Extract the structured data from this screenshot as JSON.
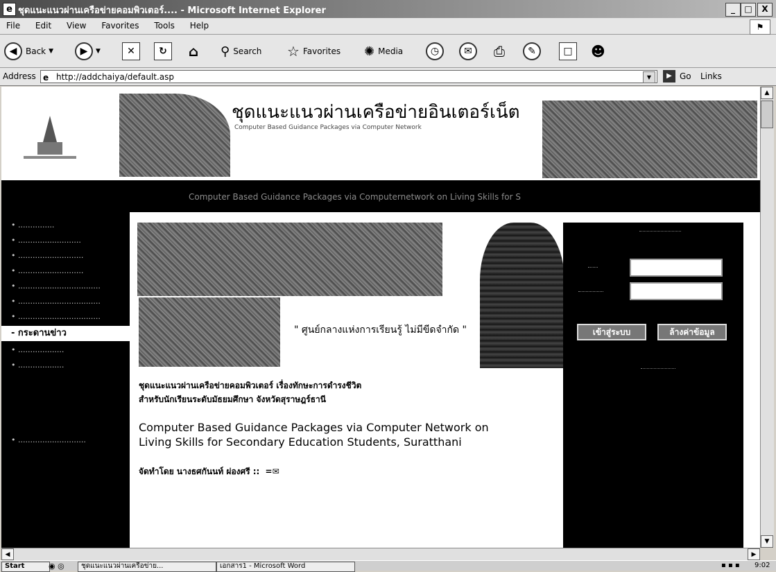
{
  "window": {
    "title": "ชุดแนะแนวผ่านเครือข่ายคอมพิวเตอร์.... - Microsoft Internet Explorer",
    "minimize": "_",
    "maximize": "□",
    "close": "X"
  },
  "menu": [
    "File",
    "Edit",
    "View",
    "Favorites",
    "Tools",
    "Help"
  ],
  "toolbar": {
    "back": "Back",
    "search": "Search",
    "favorites": "Favorites",
    "media": "Media"
  },
  "address": {
    "label": "Address",
    "url": "http://addchaiya/default.asp",
    "go": "Go",
    "links": "Links"
  },
  "banner": {
    "title_th": "ชุดแนะแนวผ่านเครือข่ายอินเตอร์เน็ต",
    "title_en": "Computer Based Guidance Packages via Computer Network",
    "band_text": "Computer Based Guidance Packages via Computernetwork on Living Skills for S"
  },
  "nav": {
    "active": "- กระดานข่าว"
  },
  "main": {
    "slogan": "\" ศูนย์กลางแห่งการเรียนรู้ ไม่มีขีดจำกัด \"",
    "desc_th_1": "ชุดแนะแนวผ่านเครือข่ายคอมพิวเตอร์ เรื่องทักษะการดำรงชีวิต",
    "desc_th_2": "สำหรับนักเรียนระดับมัธยมศึกษา จังหวัดสุราษฎร์ธานี",
    "desc_en_1": "Computer Based Guidance Packages via Computer Network on",
    "desc_en_2": "Living Skills for Secondary Education Students, Suratthani",
    "author": "จัดทำโดย นางธศกันนท์ ผ่องศรี ::"
  },
  "login": {
    "login_button": "เข้าสู่ระบบ",
    "clear_button": "ล้างค่าข้อมูล"
  },
  "taskbar": {
    "start": "Start",
    "task_ie": "ชุดแนะแนวผ่านเครือข่าย...",
    "task_word": "เอกสาร1 - Microsoft Word",
    "clock": "9:02"
  }
}
